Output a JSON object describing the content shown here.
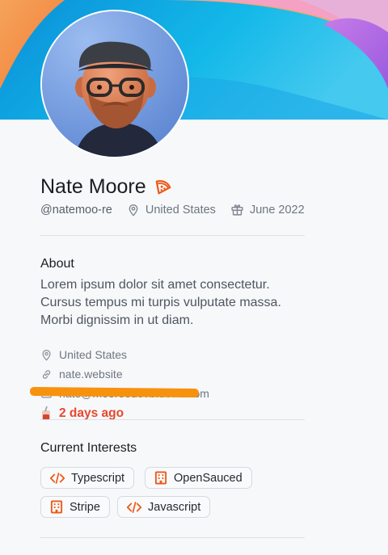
{
  "colors": {
    "accent": "#ed5a18",
    "timeago": "#e8472e",
    "redaction": "#f7920f"
  },
  "profile": {
    "name": "Nate Moore",
    "name_icon": "pizza-icon",
    "username": "@natemoo-re",
    "location": "United States",
    "joined": "June 2022"
  },
  "about": {
    "title": "About",
    "bio": "Lorem ipsum dolor sit amet consectetur. Cursus tempus mi turpis vulputate massa. Morbi dignissim in ut diam.",
    "location": "United States",
    "website": "nate.website",
    "email": "nate@mooreodevb.dev.tl.com",
    "time_ago": "2 days ago"
  },
  "interests": {
    "title": "Current Interests",
    "items": [
      {
        "label": "Typescript",
        "icon": "code-icon"
      },
      {
        "label": "OpenSauced",
        "icon": "building-icon"
      },
      {
        "label": "Stripe",
        "icon": "building-icon"
      },
      {
        "label": "Javascript",
        "icon": "code-icon"
      }
    ]
  }
}
